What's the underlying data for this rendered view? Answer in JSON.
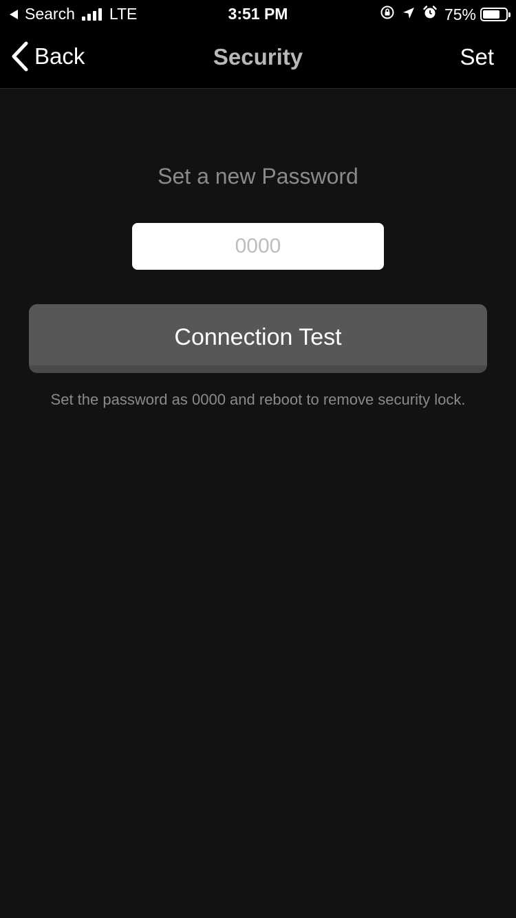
{
  "status_bar": {
    "back_app": "Search",
    "carrier": "LTE",
    "time": "3:51 PM",
    "battery_percent": "75%",
    "battery_level": 0.75,
    "icons": [
      "orientation-lock-icon",
      "location-arrow-icon",
      "alarm-icon"
    ]
  },
  "nav": {
    "back_label": "Back",
    "title": "Security",
    "set_label": "Set"
  },
  "main": {
    "prompt": "Set a new Password",
    "password_placeholder": "0000",
    "password_value": "",
    "connection_button_label": "Connection Test",
    "hint": "Set the password as 0000 and reboot to remove security lock."
  },
  "colors": {
    "background": "#121212",
    "bar": "#000000",
    "button": "#575757",
    "muted_text": "#8a8a8a",
    "title_text": "#b8b8b8"
  }
}
